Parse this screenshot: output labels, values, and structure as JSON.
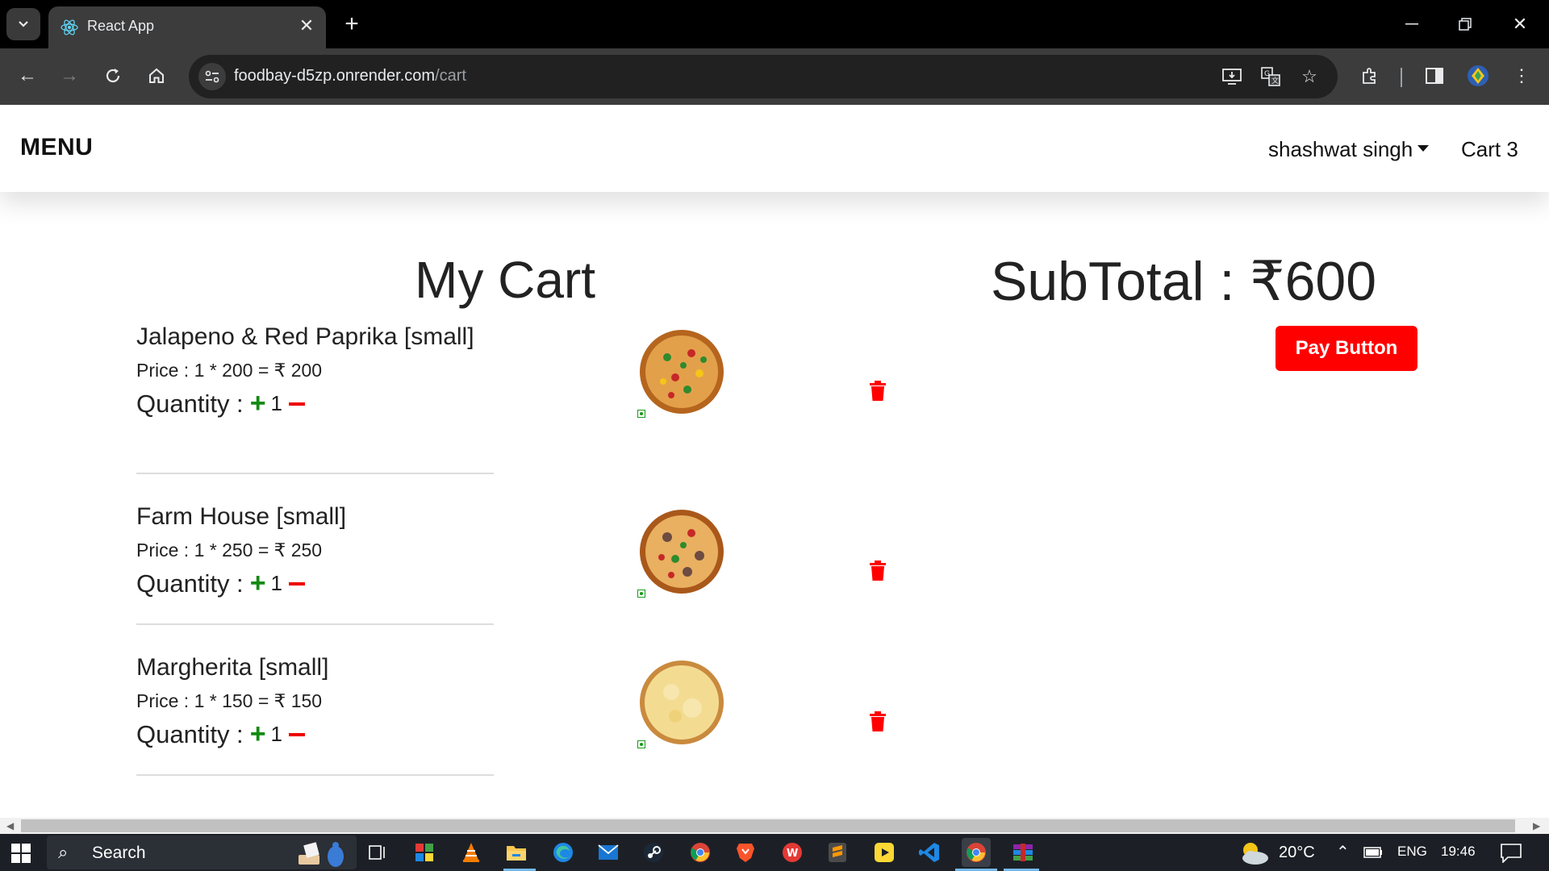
{
  "browser": {
    "tab_title": "React App",
    "url_host": "foodbay-d5zp.onrender.com",
    "url_path": "/cart"
  },
  "navbar": {
    "brand": "MENU",
    "user_name": "shashwat singh",
    "cart_label": "Cart 3"
  },
  "cart": {
    "title": "My Cart",
    "items": [
      {
        "name": "Jalapeno & Red Paprika [small]",
        "price_text": "Price : 1 * 200 = ₹ 200",
        "quantity_label": "Quantity :",
        "quantity": "1",
        "image": "pizza-jalapeno"
      },
      {
        "name": "Farm House [small]",
        "price_text": "Price : 1 * 250 = ₹ 250",
        "quantity_label": "Quantity :",
        "quantity": "1",
        "image": "pizza-farmhouse"
      },
      {
        "name": "Margherita [small]",
        "price_text": "Price : 1 * 150 = ₹ 150",
        "quantity_label": "Quantity :",
        "quantity": "1",
        "image": "pizza-margherita"
      }
    ],
    "plus_symbol": "+",
    "subtotal_text": "SubTotal : ₹600",
    "pay_button": "Pay Button"
  },
  "taskbar": {
    "search_label": "Search",
    "temperature": "20°C",
    "language": "ENG",
    "time": "19:46"
  },
  "colors": {
    "accent_red": "#ff0000",
    "qty_plus_green": "#138a13"
  }
}
